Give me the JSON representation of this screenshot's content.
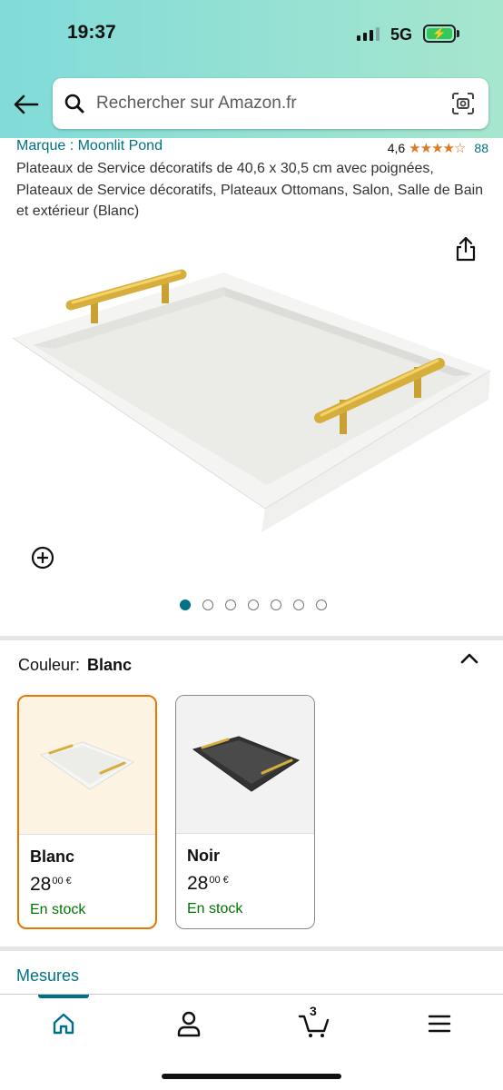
{
  "status_bar": {
    "time": "19:37",
    "network": "5G"
  },
  "search": {
    "placeholder": "Rechercher sur Amazon.fr"
  },
  "product": {
    "brand": "Marque : Moonlit Pond",
    "rating": "4,6",
    "rating_value": 4.6,
    "review_count": "88",
    "title": "Plateaux de Service décoratifs de 40,6 x 30,5 cm avec poignées, Plateaux de Service décoratifs, Plateaux Ottomans, Salon, Salle de Bain et extérieur (Blanc)",
    "image_index": 1,
    "image_total": 7
  },
  "variation": {
    "label": "Couleur:",
    "selected": "Blanc",
    "options": [
      {
        "name": "Blanc",
        "price_whole": "28",
        "price_fraction": "00 €",
        "stock": "En stock"
      },
      {
        "name": "Noir",
        "price_whole": "28",
        "price_fraction": "00 €",
        "stock": "En stock"
      }
    ]
  },
  "measures": {
    "label": "Mesures"
  },
  "nav": {
    "cart_count": "3"
  },
  "colors": {
    "accent": "#007185",
    "star": "#de7921",
    "stock": "#007600",
    "selected_border": "#e77600"
  }
}
